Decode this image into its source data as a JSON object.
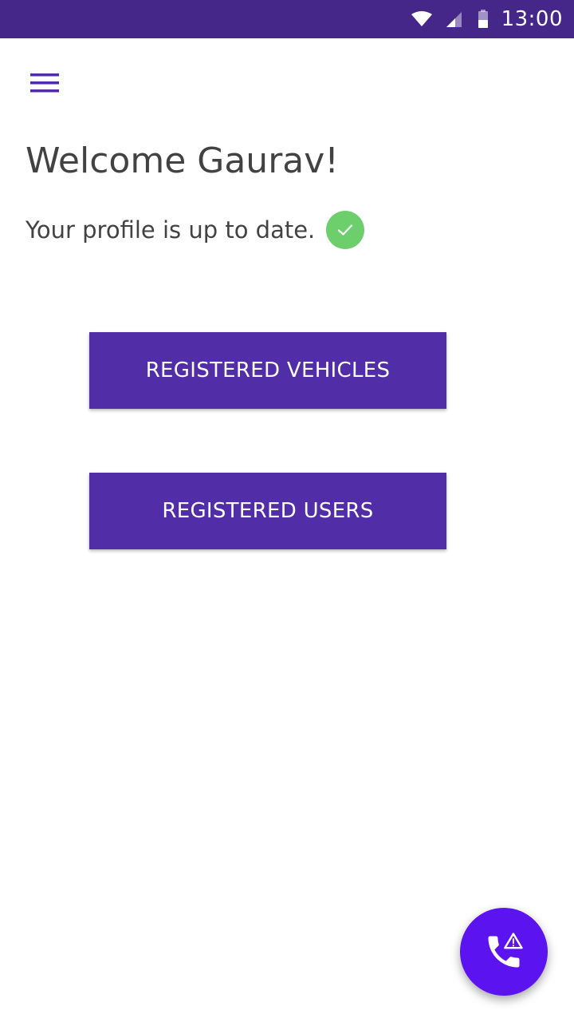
{
  "status_bar": {
    "time": "13:00",
    "background_color": "#45278a",
    "icons": [
      "wifi-icon",
      "cell-signal-icon",
      "battery-icon"
    ]
  },
  "toolbar": {
    "menu_icon": "hamburger-menu-icon",
    "accent_color": "#522da8"
  },
  "main": {
    "welcome_title": "Welcome Gaurav!",
    "profile_status": "Your profile is up to date.",
    "profile_status_icon": "check-circle-icon",
    "profile_status_color": "#6ccf6c",
    "buttons": [
      {
        "label": "REGISTERED VEHICLES"
      },
      {
        "label": "REGISTERED USERS"
      }
    ],
    "button_color": "#522da8"
  },
  "fab": {
    "icon": "emergency-call-icon",
    "color": "#5b13f0"
  }
}
